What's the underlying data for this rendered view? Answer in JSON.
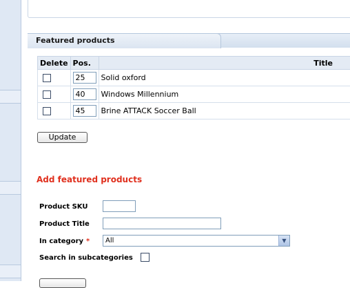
{
  "section": {
    "title": "Featured products"
  },
  "table": {
    "headers": {
      "delete": "Delete",
      "pos": "Pos.",
      "title": "Title"
    },
    "rows": [
      {
        "pos": "25",
        "title": "Solid oxford"
      },
      {
        "pos": "40",
        "title": "Windows Millennium"
      },
      {
        "pos": "45",
        "title": "Brine ATTACK Soccer Ball"
      }
    ]
  },
  "buttons": {
    "update": "Update",
    "search": ""
  },
  "add_form": {
    "title": "Add featured products",
    "sku_label": "Product SKU",
    "title_label": "Product Title",
    "category_label": "In category",
    "required_mark": "*",
    "category_value": "All",
    "subcategories_label": "Search in subcategories"
  },
  "colors": {
    "accent_red": "#e0301e",
    "header_blue": "#e4ebf4"
  }
}
